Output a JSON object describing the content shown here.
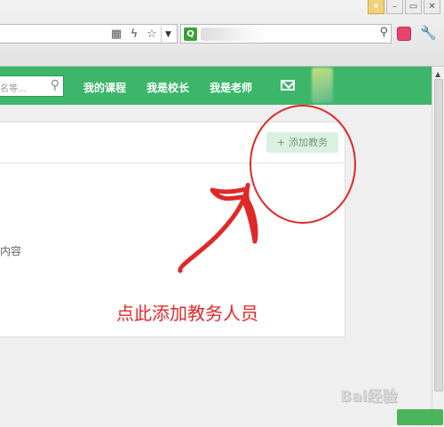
{
  "browser": {
    "search_engine_icon": "search-engine-icon",
    "dropdown_glyph": "▼",
    "addr_icons": [
      "qr-code-icon",
      "lightning-icon",
      "star-icon"
    ]
  },
  "nav": {
    "search_placeholder": "名等...",
    "links": [
      "我的课程",
      "我是校长",
      "我是老师"
    ],
    "brand_color": "#3cb66a"
  },
  "panel": {
    "add_staff_label": "添加教务",
    "content_fragment": "内容"
  },
  "annotation": {
    "text": "点此添加教务人员",
    "color": "#e02828"
  },
  "watermark": {
    "text": "Bai经验"
  }
}
